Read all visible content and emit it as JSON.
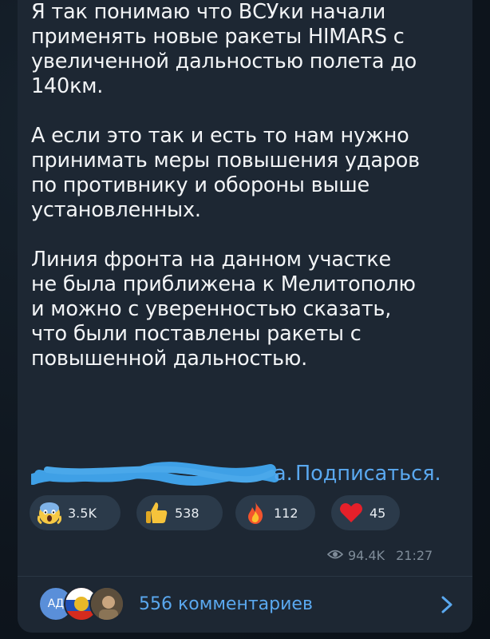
{
  "message": {
    "paragraph1": "Я так понимаю что ВСУки начали\nприменять новые ракеты HIMARS с\nувеличенной дальностью полета до\n140км.",
    "paragraph2": "А если это так и есть то нам нужно\nпринимать меры повышения ударов\nпо противнику и обороны выше\nустановленных.",
    "paragraph3": "Линия фронта на данном участке\nне была приближена к Мелитополю\nи можно с уверенностью сказать,\nчто были поставлены ракеты с\nповышенной дальностью.",
    "redacted_tail": "а.",
    "subscribe_label": "Подписаться."
  },
  "reactions": [
    {
      "icon": "scream-face-icon",
      "count": "3.5K"
    },
    {
      "icon": "thumbs-up-icon",
      "count": "538"
    },
    {
      "icon": "fire-icon",
      "count": "112"
    },
    {
      "icon": "red-heart-icon",
      "count": "45"
    }
  ],
  "meta": {
    "views": "94.4K",
    "time": "21:27"
  },
  "comments": {
    "first_avatar_initials": "АД",
    "label": "556 комментариев"
  },
  "colors": {
    "background": "#0f1720",
    "bubble": "#1d2733",
    "text": "#f2f4f6",
    "accent_link": "#5aa8ef",
    "reaction_pill": "#2b3a4a",
    "meta_text": "#7f8c99",
    "redaction_scribble": "#3fa0e6"
  }
}
